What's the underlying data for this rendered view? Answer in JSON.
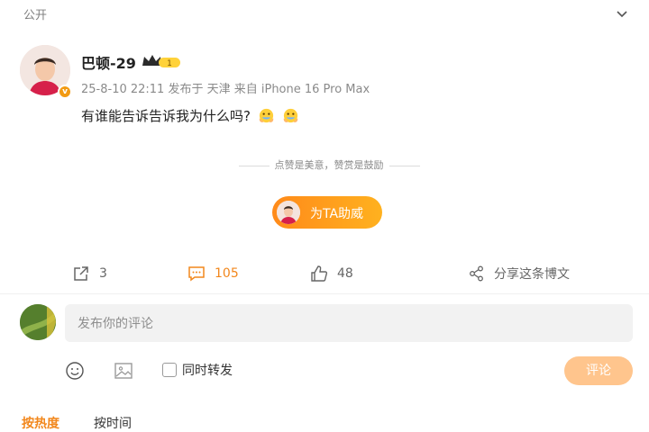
{
  "header": {
    "visibility": "公开"
  },
  "post": {
    "username": "巴顿-29",
    "vip_level": "1",
    "meta": "25-8-10 22:11  发布于 天津  来自 iPhone 16 Pro Max",
    "text": "有谁能告诉告诉我为什么吗?"
  },
  "appreciation": {
    "slogan": "点赞是美意，赞赏是鼓励",
    "tip_button": "为TA助威"
  },
  "actions": {
    "repost_count": "3",
    "comment_count": "105",
    "like_count": "48",
    "share_label": "分享这条博文"
  },
  "comment_box": {
    "placeholder": "发布你的评论",
    "forward_label": "同时转发",
    "submit_label": "评论"
  },
  "sort": {
    "hot_label": "按热度",
    "time_label": "按时间"
  },
  "colors": {
    "accent": "#f2871c",
    "tip_gradient_start": "#ff8a1a",
    "tip_gradient_end": "#ffb11f",
    "submit_disabled": "#ffc58d"
  },
  "icons": [
    "chevron-down-icon",
    "vip-crown-icon",
    "verified-badge-icon",
    "emoji-icon",
    "repost-icon",
    "comment-icon",
    "like-icon",
    "share-icon",
    "smile-icon",
    "image-icon"
  ]
}
